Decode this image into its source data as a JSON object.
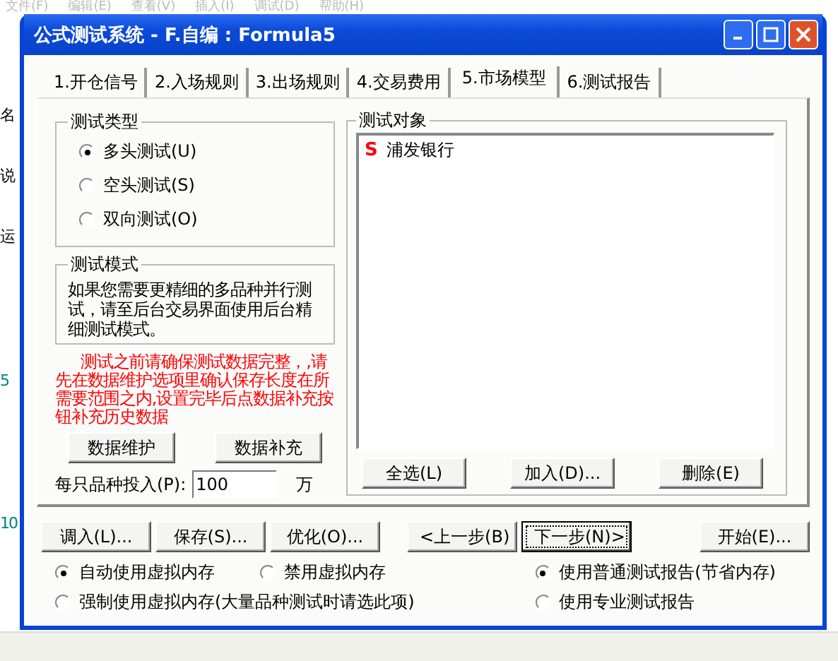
{
  "background_app": {
    "menu": [
      "文件(F)",
      "编辑(E)",
      "查看(V)",
      "插入(I)",
      "调试(D)",
      "帮助(H)"
    ],
    "side_labels": [
      "名",
      "说",
      "运",
      "5",
      "10"
    ]
  },
  "window": {
    "title": "公式测试系统 - F.自编 : Formula5"
  },
  "tabs": [
    {
      "label": "1.开仓信号",
      "selected": false
    },
    {
      "label": "2.入场规则",
      "selected": false
    },
    {
      "label": "3.出场规则",
      "selected": false
    },
    {
      "label": "4.交易费用",
      "selected": false
    },
    {
      "label": "5.市场模型",
      "selected": true
    },
    {
      "label": "6.测试报告",
      "selected": false
    }
  ],
  "test_type": {
    "title": "测试类型",
    "options": [
      {
        "label": "多头测试(U)",
        "selected": true
      },
      {
        "label": "空头测试(S)",
        "selected": false
      },
      {
        "label": "双向测试(O)",
        "selected": false
      }
    ]
  },
  "test_mode": {
    "title": "测试模式",
    "text": "如果您需要更精细的多品种并行测试，请至后台交易界面使用后台精细测试模式。"
  },
  "warning": "测试之前请确保测试数据完整，,请先在数据维护选项里确认保存长度在所需要范围之内,设置完毕后点数据补充按钮补充历史数据",
  "data_buttons": [
    "数据维护",
    "数据补充"
  ],
  "investment": {
    "label": "每只品种投入(P):",
    "value": "100",
    "unit": "万"
  },
  "test_objects": {
    "title": "测试对象",
    "items": [
      {
        "badge": "S",
        "name": "浦发银行"
      }
    ],
    "buttons": [
      "全选(L)",
      "加入(D)...",
      "删除(E)"
    ]
  },
  "nav_buttons": [
    {
      "label": "调入(L)...",
      "focused": false
    },
    {
      "label": "保存(S)...",
      "focused": false
    },
    {
      "label": "优化(O)...",
      "focused": false
    },
    {
      "label": "<上一步(B)",
      "focused": false
    },
    {
      "label": "下一步(N)>",
      "focused": true
    },
    {
      "label": "开始(E)...",
      "focused": false
    }
  ],
  "memory_options": [
    {
      "label": "自动使用虚拟内存",
      "selected": true
    },
    {
      "label": "禁用虚拟内存",
      "selected": false
    },
    {
      "label": "强制使用虚拟内存(大量品种测试时请选此项)",
      "selected": false
    }
  ],
  "report_options": [
    {
      "label": "使用普通测试报告(节省内存)",
      "selected": true
    },
    {
      "label": "使用专业测试报告",
      "selected": false
    }
  ]
}
